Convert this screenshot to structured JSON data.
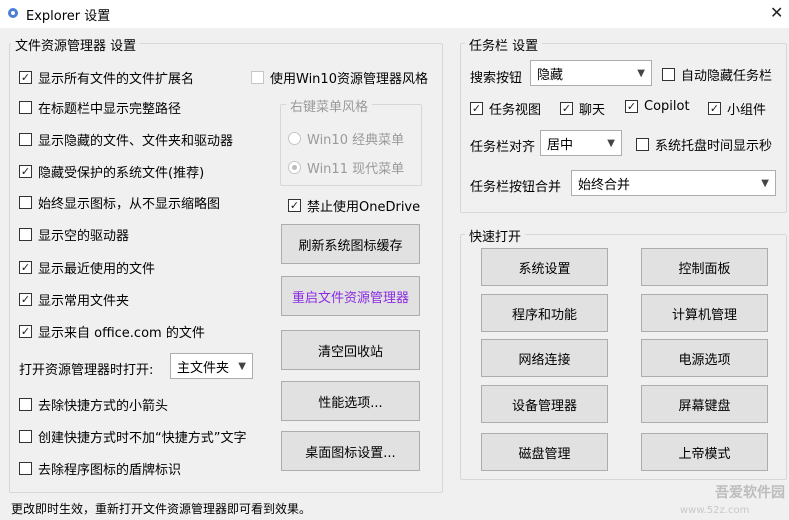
{
  "window": {
    "title": "Explorer 设置",
    "close_glyph": "✕"
  },
  "explorer": {
    "group_title": "文件资源管理器 设置",
    "options": [
      {
        "label": "显示所有文件的文件扩展名",
        "checked": true
      },
      {
        "label": "在标题栏中显示完整路径",
        "checked": false
      },
      {
        "label": "显示隐藏的文件、文件夹和驱动器",
        "checked": false
      },
      {
        "label": "隐藏受保护的系统文件(推荐)",
        "checked": true
      },
      {
        "label": "始终显示图标，从不显示缩略图",
        "checked": false
      },
      {
        "label": "显示空的驱动器",
        "checked": false
      },
      {
        "label": "显示最近使用的文件",
        "checked": true
      },
      {
        "label": "显示常用文件夹",
        "checked": true
      },
      {
        "label": "显示来自 office.com 的文件",
        "checked": true
      }
    ],
    "open_label": "打开资源管理器时打开:",
    "open_value": "主文件夹",
    "bottom_options": [
      {
        "label": "去除快捷方式的小箭头",
        "checked": false
      },
      {
        "label": "创建快捷方式时不加“快捷方式”文字",
        "checked": false
      },
      {
        "label": "去除程序图标的盾牌标识",
        "checked": false
      }
    ],
    "win10_explorer_label": "使用Win10资源管理器风格",
    "context_menu": {
      "title": "右键菜单风格",
      "options": [
        {
          "label": "Win10 经典菜单",
          "selected": false
        },
        {
          "label": "Win11 现代菜单",
          "selected": true
        }
      ]
    },
    "onedrive_label": "禁止使用OneDrive",
    "buttons": [
      "刷新系统图标缓存",
      "重启文件资源管理器",
      "清空回收站",
      "性能选项...",
      "桌面图标设置..."
    ],
    "accent_color": "#8a2be2"
  },
  "taskbar": {
    "group_title": "任务栏 设置",
    "search_label": "搜索按钮",
    "search_value": "隐藏",
    "autohide_label": "自动隐藏任务栏",
    "items": [
      {
        "label": "任务视图",
        "checked": true
      },
      {
        "label": "聊天",
        "checked": true
      },
      {
        "label": "Copilot",
        "checked": true
      },
      {
        "label": "小组件",
        "checked": true
      }
    ],
    "align_label": "任务栏对齐",
    "align_value": "居中",
    "tray_seconds_label": "系统托盘时间显示秒",
    "merge_label": "任务栏按钮合并",
    "merge_value": "始终合并"
  },
  "quick": {
    "group_title": "快速打开",
    "buttons": [
      "系统设置",
      "控制面板",
      "程序和功能",
      "计算机管理",
      "网络连接",
      "电源选项",
      "设备管理器",
      "屏幕键盘",
      "磁盘管理",
      "上帝模式"
    ]
  },
  "status_text": "更改即时生效，重新打开文件资源管理器即可看到效果。",
  "watermark": {
    "brand": "吾爱软件园",
    "url": "www.52z.com"
  }
}
